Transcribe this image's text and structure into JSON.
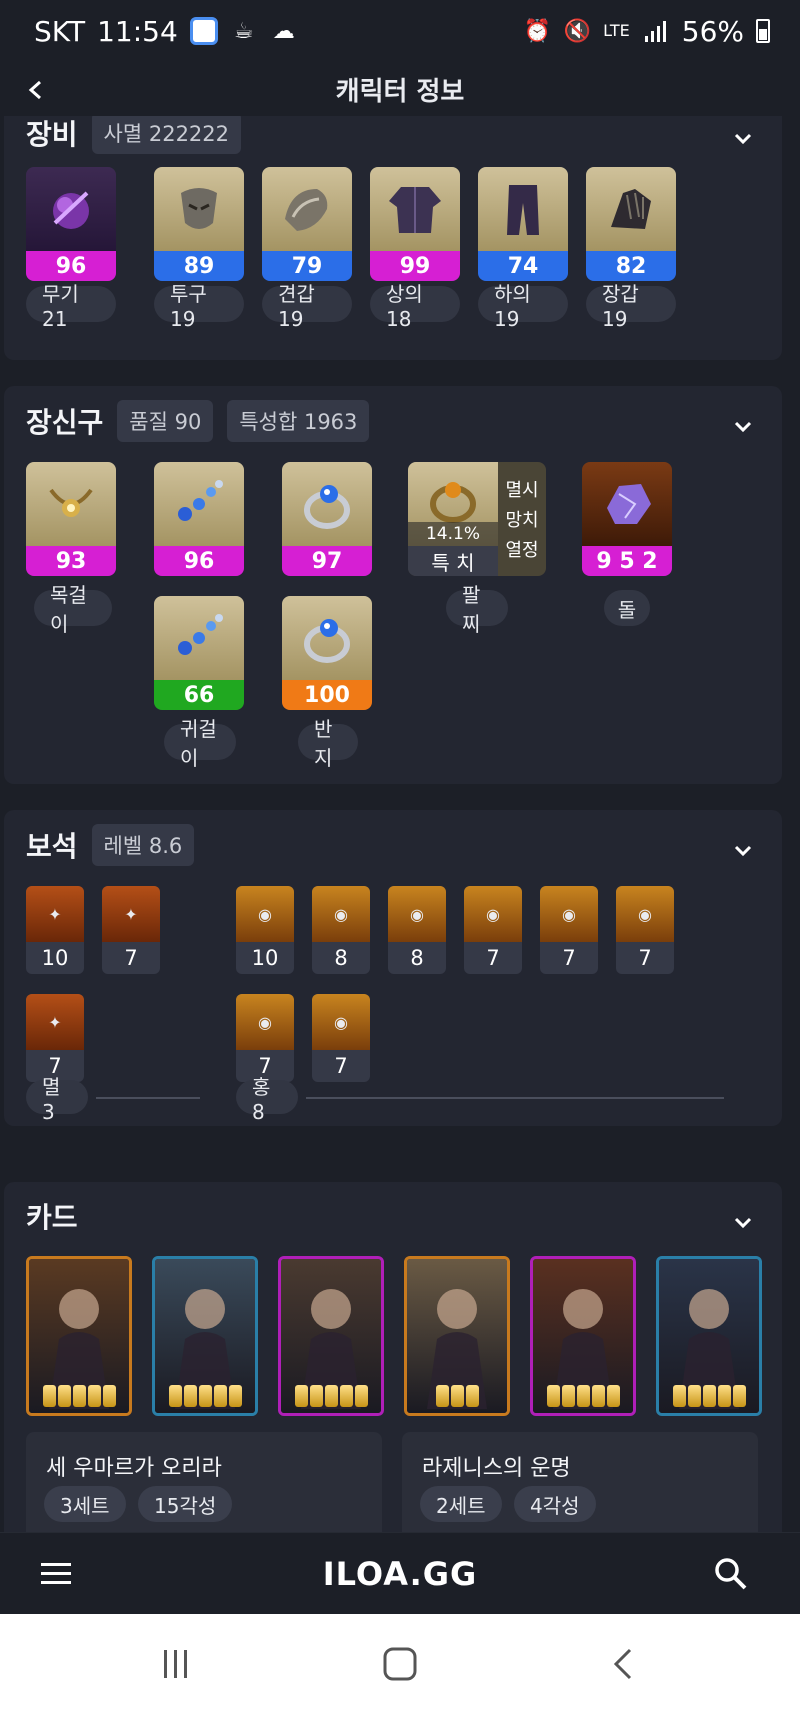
{
  "status_bar": {
    "carrier": "SKT",
    "time": "11:54",
    "network": "LTE",
    "battery": "56%"
  },
  "header": {
    "title": "캐릭터 정보"
  },
  "equipment": {
    "title": "장비",
    "chip": "사멸 222222",
    "items": [
      {
        "quality": "96",
        "bar_color": "#d61fd3",
        "label": "무기 21"
      },
      {
        "quality": "89",
        "bar_color": "#2b6ee8",
        "label": "투구 19"
      },
      {
        "quality": "79",
        "bar_color": "#2b6ee8",
        "label": "견갑 19"
      },
      {
        "quality": "99",
        "bar_color": "#d61fd3",
        "label": "상의 18"
      },
      {
        "quality": "74",
        "bar_color": "#2b6ee8",
        "label": "하의 19"
      },
      {
        "quality": "82",
        "bar_color": "#2b6ee8",
        "label": "장갑 19"
      }
    ]
  },
  "accessories": {
    "title": "장신구",
    "chip_quality": "품질 90",
    "chip_stats": "특성합 1963",
    "items": [
      {
        "quality": "93",
        "bar_color": "#d61fd3",
        "label": "목걸이"
      },
      {
        "quality": "96",
        "bar_color": "#d61fd3"
      },
      {
        "quality": "97",
        "bar_color": "#d61fd3"
      },
      {
        "quality": "66",
        "bar_color": "#20a820",
        "label": "귀걸이"
      },
      {
        "quality": "100",
        "bar_color": "#f07a16",
        "label": "반지"
      }
    ],
    "bracelet": {
      "percent": "14.1%",
      "stat": "특 치",
      "effects": [
        "멸시",
        "망치",
        "열정"
      ],
      "label": "팔찌"
    },
    "stone": {
      "value": "9 5 2",
      "label": "돌"
    }
  },
  "gems": {
    "title": "보석",
    "chip": "레벨 8.6",
    "red_group": {
      "levels": [
        "10",
        "7",
        "7"
      ],
      "label": "멸 3"
    },
    "orange_group": {
      "levels": [
        "10",
        "8",
        "8",
        "7",
        "7",
        "7",
        "7",
        "7"
      ],
      "label": "홍 8"
    }
  },
  "cards": {
    "title": "카드",
    "cards": [
      {
        "border": "#c87a1e",
        "awaken": 5
      },
      {
        "border": "#2a7fa8",
        "awaken": 5
      },
      {
        "border": "#b01fb8",
        "awaken": 5
      },
      {
        "border": "#c87a1e",
        "awaken": 3
      },
      {
        "border": "#b01fb8",
        "awaken": 5
      },
      {
        "border": "#2a7fa8",
        "awaken": 5
      }
    ],
    "sets": [
      {
        "name": "세 우마르가 오리라",
        "set_count": "3세트",
        "awaken": "15각성"
      },
      {
        "name": "라제니스의 운명",
        "set_count": "2세트",
        "awaken": "4각성"
      }
    ]
  },
  "app_bar": {
    "brand": "ILOA.GG"
  }
}
